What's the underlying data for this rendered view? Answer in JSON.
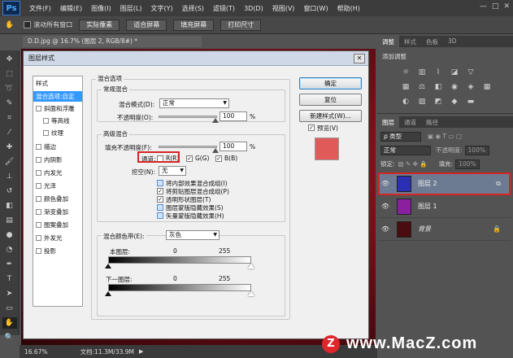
{
  "app": {
    "logo": "Ps",
    "menu": [
      "文件(F)",
      "编辑(E)",
      "图像(I)",
      "图层(L)",
      "文字(Y)",
      "选择(S)",
      "滤镜(T)",
      "3D(D)",
      "视图(V)",
      "窗口(W)",
      "帮助(H)"
    ],
    "window_controls": [
      "—",
      "□",
      "✕"
    ]
  },
  "options_bar": {
    "scroll_all_label": "滚动所有窗口",
    "buttons": [
      "实际像素",
      "适合屏幕",
      "填充屏幕",
      "打印尺寸"
    ]
  },
  "document": {
    "tab_title": "D.D.jpg @ 16.7% (图层 2, RGB/8#) *",
    "zoom": "16.67%",
    "doc_info": "文档:11.3M/33.9M"
  },
  "right_panel": {
    "top_tabs": [
      "调整",
      "样式",
      "色板",
      "3D"
    ],
    "adjust_title": "添加调整",
    "layers_tabs": [
      "图层",
      "通道",
      "路径"
    ],
    "kind_label": "ρ 类型",
    "blend_mode": "正常",
    "opacity_label": "不透明度:",
    "opacity_value": "100%",
    "lock_label": "锁定:",
    "fill_label": "填充:",
    "fill_value": "100%",
    "layers": [
      {
        "name": "图层 2",
        "selected": true,
        "color": "#2a2fb3"
      },
      {
        "name": "图层 1",
        "selected": false,
        "color": "#8a1fa0"
      },
      {
        "name": "背景",
        "selected": false,
        "color": "#4a0c10"
      }
    ]
  },
  "dialog": {
    "title": "图层样式",
    "close": "✕",
    "styles_header": "样式",
    "style_items": [
      {
        "label": "混合选项:自定",
        "checkbox": false,
        "selected": true,
        "indent": false
      },
      {
        "label": "斜面和浮雕",
        "checkbox": true,
        "selected": false,
        "indent": false
      },
      {
        "label": "等高线",
        "checkbox": true,
        "selected": false,
        "indent": true
      },
      {
        "label": "纹理",
        "checkbox": true,
        "selected": false,
        "indent": true
      },
      {
        "label": "描边",
        "checkbox": true,
        "selected": false,
        "indent": false
      },
      {
        "label": "内阴影",
        "checkbox": true,
        "selected": false,
        "indent": false
      },
      {
        "label": "内发光",
        "checkbox": true,
        "selected": false,
        "indent": false
      },
      {
        "label": "光泽",
        "checkbox": true,
        "selected": false,
        "indent": false
      },
      {
        "label": "颜色叠加",
        "checkbox": true,
        "selected": false,
        "indent": false
      },
      {
        "label": "渐变叠加",
        "checkbox": true,
        "selected": false,
        "indent": false
      },
      {
        "label": "图案叠加",
        "checkbox": true,
        "selected": false,
        "indent": false
      },
      {
        "label": "外发光",
        "checkbox": true,
        "selected": false,
        "indent": false
      },
      {
        "label": "投影",
        "checkbox": true,
        "selected": false,
        "indent": false
      }
    ],
    "blend_options_title": "混合选项",
    "general_blend_title": "常规混合",
    "blend_mode_label": "混合模式(D):",
    "blend_mode_value": "正常",
    "opacity_label": "不透明度(O):",
    "opacity_value": "100",
    "percent": "%",
    "advanced_blend_title": "高级混合",
    "fill_opacity_label": "填充不透明度(F):",
    "fill_opacity_value": "100",
    "channels_label": "通道:",
    "channel_r": "R(R)",
    "channel_g": "G(G)",
    "channel_b": "B(B)",
    "knockout_label": "挖空(N):",
    "knockout_value": "无",
    "adv_checks": [
      {
        "label": "将内部效果混合成组(I)",
        "checked": false
      },
      {
        "label": "将剪贴图层混合成组(P)",
        "checked": true
      },
      {
        "label": "透明形状图层(T)",
        "checked": true
      },
      {
        "label": "图层蒙版隐藏效果(S)",
        "checked": false
      },
      {
        "label": "矢量蒙版隐藏效果(H)",
        "checked": false
      }
    ],
    "blend_if_label": "混合颜色带(E):",
    "blend_if_value": "灰色",
    "this_layer_label": "本图层:",
    "under_layer_label": "下一图层:",
    "range_min": "0",
    "range_max": "255",
    "ok_label": "确定",
    "reset_label": "复位",
    "new_style_label": "新建样式(W)...",
    "preview_label": "预览(V)",
    "preview_color": "#e05a5a"
  },
  "watermark": {
    "logo": "Z",
    "text": "www.MacZ.com"
  },
  "accent_red": "#d62424"
}
